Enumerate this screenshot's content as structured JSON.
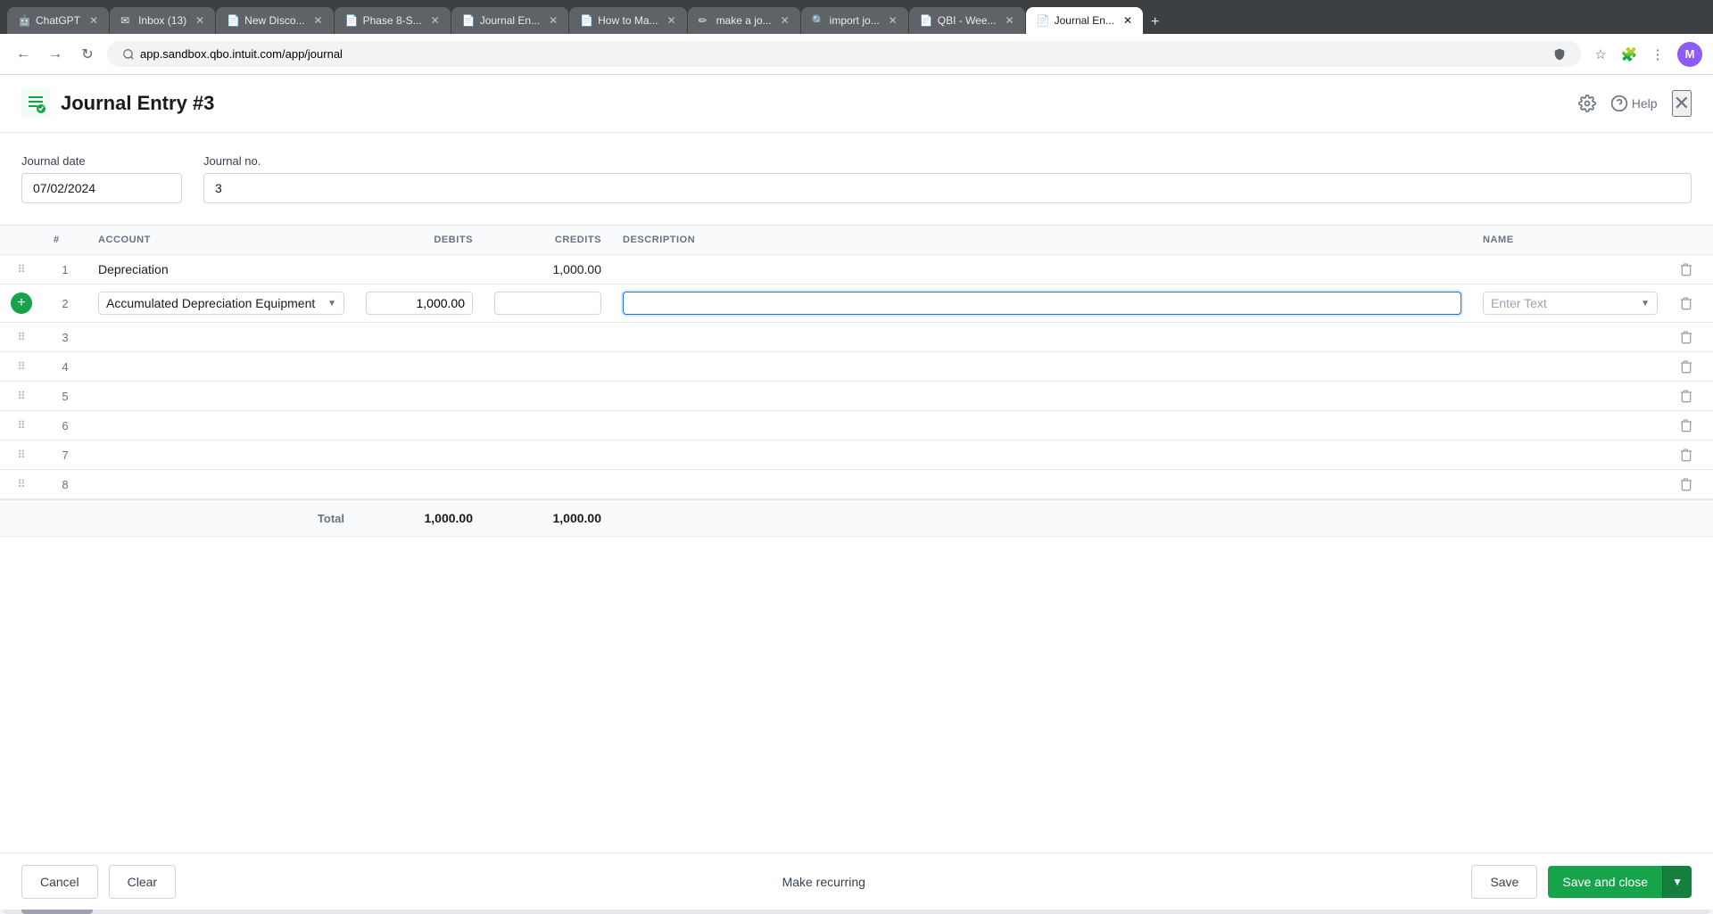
{
  "browser": {
    "tabs": [
      {
        "id": "chatgpt",
        "title": "ChatGPT",
        "favicon": "🤖",
        "active": false
      },
      {
        "id": "inbox",
        "title": "Inbox (13)",
        "favicon": "✉",
        "active": false
      },
      {
        "id": "newdisco",
        "title": "New Disco...",
        "favicon": "📄",
        "active": false
      },
      {
        "id": "phase8",
        "title": "Phase 8-S...",
        "favicon": "📄",
        "active": false
      },
      {
        "id": "journalentry1",
        "title": "Journal En...",
        "favicon": "📄",
        "active": false
      },
      {
        "id": "howto",
        "title": "How to Ma...",
        "favicon": "📄",
        "active": false
      },
      {
        "id": "makea",
        "title": "make a jo...",
        "favicon": "✏",
        "active": false
      },
      {
        "id": "importjo",
        "title": "import jo...",
        "favicon": "🔍",
        "active": false
      },
      {
        "id": "qbi",
        "title": "QBI - Wee...",
        "favicon": "📄",
        "active": false
      },
      {
        "id": "journalentry2",
        "title": "Journal En...",
        "favicon": "📄",
        "active": true
      }
    ],
    "url": "app.sandbox.qbo.intuit.com/app/journal"
  },
  "header": {
    "title": "Journal Entry #3",
    "help_label": "Help"
  },
  "form": {
    "journal_date_label": "Journal date",
    "journal_date_value": "07/02/2024",
    "journal_no_label": "Journal no.",
    "journal_no_value": "3"
  },
  "table": {
    "columns": {
      "hash": "#",
      "account": "ACCOUNT",
      "debits": "DEBITS",
      "credits": "CREDITS",
      "description": "DESCRIPTION",
      "name": "NAME"
    },
    "rows": [
      {
        "num": 1,
        "account": "Depreciation",
        "debits": "",
        "credits": "1,000.00",
        "description": "",
        "name": ""
      },
      {
        "num": 2,
        "account": "Accumulated Depreciation Equipment",
        "debits": "1,000.00",
        "credits": "",
        "description": "",
        "name": "",
        "is_active": true
      },
      {
        "num": 3,
        "account": "",
        "debits": "",
        "credits": "",
        "description": "",
        "name": ""
      },
      {
        "num": 4,
        "account": "",
        "debits": "",
        "credits": "",
        "description": "",
        "name": ""
      },
      {
        "num": 5,
        "account": "",
        "debits": "",
        "credits": "",
        "description": "",
        "name": ""
      },
      {
        "num": 6,
        "account": "",
        "debits": "",
        "credits": "",
        "description": "",
        "name": ""
      },
      {
        "num": 7,
        "account": "",
        "debits": "",
        "credits": "",
        "description": "",
        "name": ""
      },
      {
        "num": 8,
        "account": "",
        "debits": "",
        "credits": "",
        "description": "",
        "name": ""
      }
    ],
    "total_label": "Total",
    "total_debits": "1,000.00",
    "total_credits": "1,000.00"
  },
  "footer": {
    "cancel_label": "Cancel",
    "clear_label": "Clear",
    "make_recurring_label": "Make recurring",
    "save_label": "Save",
    "save_close_label": "Save and close"
  }
}
